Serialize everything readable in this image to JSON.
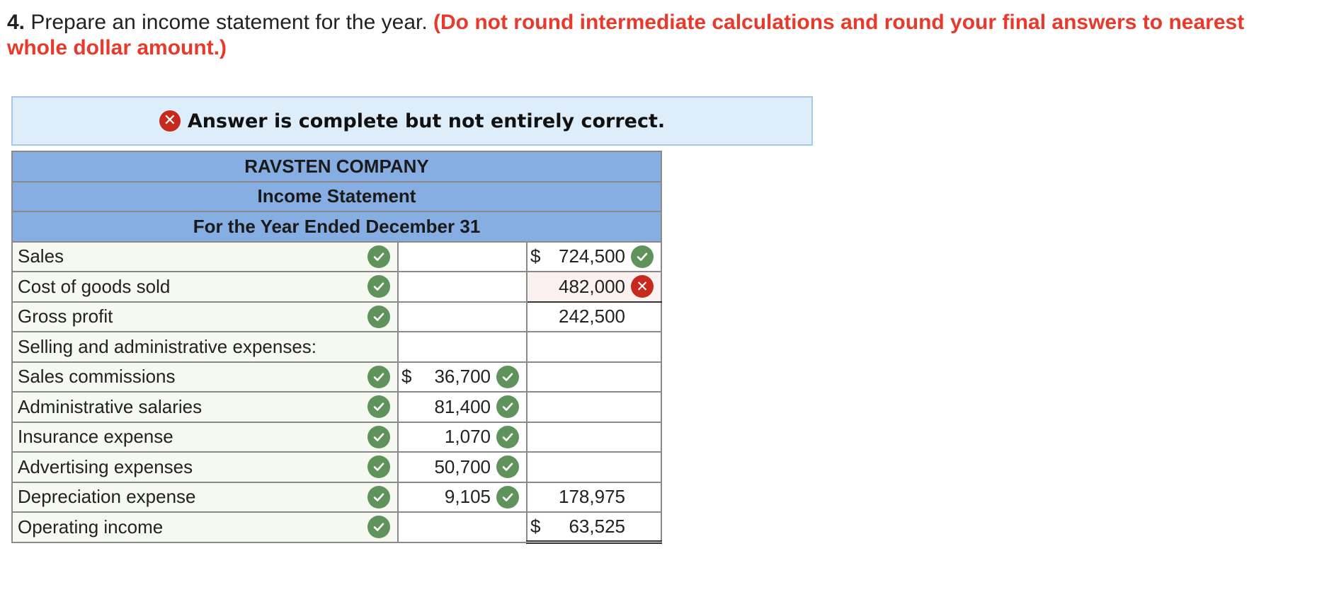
{
  "question": {
    "number": "4.",
    "text": " Prepare an income statement for the year. ",
    "instruction": "(Do not round intermediate calculations and round your final answers to nearest whole dollar amount.)"
  },
  "banner": {
    "message": "Answer is complete but not entirely correct.",
    "icon": "x-circle-icon"
  },
  "statement": {
    "company": "RAVSTEN COMPANY",
    "title": "Income Statement",
    "period": "For the Year Ended December 31",
    "rows": [
      {
        "label": "Sales",
        "mid_dollar": "",
        "mid": "",
        "mid_mark": "",
        "right_dollar": "$",
        "right": "724,500",
        "right_mark": "check",
        "label_mark": "check"
      },
      {
        "label": "Cost of goods sold",
        "mid_dollar": "",
        "mid": "",
        "mid_mark": "",
        "right_dollar": "",
        "right": "482,000",
        "right_mark": "x",
        "label_mark": "check"
      },
      {
        "label": "Gross profit",
        "mid_dollar": "",
        "mid": "",
        "mid_mark": "",
        "right_dollar": "",
        "right": "242,500",
        "right_mark": "",
        "label_mark": "check"
      },
      {
        "label": "Selling and administrative expenses:",
        "mid_dollar": "",
        "mid": "",
        "mid_mark": "",
        "right_dollar": "",
        "right": "",
        "right_mark": "",
        "label_mark": ""
      },
      {
        "label": "Sales commissions",
        "mid_dollar": "$",
        "mid": "36,700",
        "mid_mark": "check",
        "right_dollar": "",
        "right": "",
        "right_mark": "",
        "label_mark": "check"
      },
      {
        "label": "Administrative salaries",
        "mid_dollar": "",
        "mid": "81,400",
        "mid_mark": "check",
        "right_dollar": "",
        "right": "",
        "right_mark": "",
        "label_mark": "check"
      },
      {
        "label": "Insurance expense",
        "mid_dollar": "",
        "mid": "1,070",
        "mid_mark": "check",
        "right_dollar": "",
        "right": "",
        "right_mark": "",
        "label_mark": "check"
      },
      {
        "label": "Advertising expenses",
        "mid_dollar": "",
        "mid": "50,700",
        "mid_mark": "check",
        "right_dollar": "",
        "right": "",
        "right_mark": "",
        "label_mark": "check"
      },
      {
        "label": "Depreciation expense",
        "mid_dollar": "",
        "mid": "9,105",
        "mid_mark": "check",
        "right_dollar": "",
        "right": "178,975",
        "right_mark": "",
        "label_mark": "check"
      },
      {
        "label": "Operating income",
        "mid_dollar": "",
        "mid": "",
        "mid_mark": "",
        "right_dollar": "$",
        "right": "63,525",
        "right_mark": "",
        "label_mark": "check"
      }
    ]
  },
  "colors": {
    "correct": "#5f935b",
    "incorrect": "#c8291f",
    "header": "#86aee3",
    "banner": "#deedfa",
    "instruction": "#e8392b"
  }
}
